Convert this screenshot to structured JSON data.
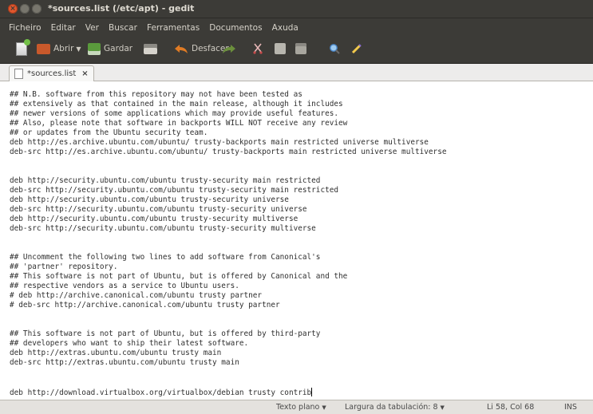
{
  "window": {
    "title": "*sources.list (/etc/apt) - gedit"
  },
  "menubar": {
    "items": [
      "Ficheiro",
      "Editar",
      "Ver",
      "Buscar",
      "Ferramentas",
      "Documentos",
      "Axuda"
    ]
  },
  "toolbar": {
    "open_label": "Abrir",
    "save_label": "Gardar",
    "undo_label": "Desfacer"
  },
  "tab": {
    "label": "*sources.list",
    "close": "×"
  },
  "editor": {
    "lines": [
      "## N.B. software from this repository may not have been tested as",
      "## extensively as that contained in the main release, although it includes",
      "## newer versions of some applications which may provide useful features.",
      "## Also, please note that software in backports WILL NOT receive any review",
      "## or updates from the Ubuntu security team.",
      "deb http://es.archive.ubuntu.com/ubuntu/ trusty-backports main restricted universe multiverse",
      "deb-src http://es.archive.ubuntu.com/ubuntu/ trusty-backports main restricted universe multiverse",
      "",
      "deb http://security.ubuntu.com/ubuntu trusty-security main restricted",
      "deb-src http://security.ubuntu.com/ubuntu trusty-security main restricted",
      "deb http://security.ubuntu.com/ubuntu trusty-security universe",
      "deb-src http://security.ubuntu.com/ubuntu trusty-security universe",
      "deb http://security.ubuntu.com/ubuntu trusty-security multiverse",
      "deb-src http://security.ubuntu.com/ubuntu trusty-security multiverse",
      "",
      "## Uncomment the following two lines to add software from Canonical's",
      "## 'partner' repository.",
      "## This software is not part of Ubuntu, but is offered by Canonical and the",
      "## respective vendors as a service to Ubuntu users.",
      "# deb http://archive.canonical.com/ubuntu trusty partner",
      "# deb-src http://archive.canonical.com/ubuntu trusty partner",
      "",
      "## This software is not part of Ubuntu, but is offered by third-party",
      "## developers who want to ship their latest software.",
      "deb http://extras.ubuntu.com/ubuntu trusty main",
      "deb-src http://extras.ubuntu.com/ubuntu trusty main",
      "",
      "deb http://download.virtualbox.org/virtualbox/debian trusty contrib"
    ]
  },
  "statusbar": {
    "syntax": "Texto plano",
    "tab_width": "Largura da tabulación: 8",
    "position": "Li 58, Col 68",
    "insert_mode": "INS"
  },
  "colors": {
    "chrome_dark": "#3c3b37",
    "close_button": "#e2572d",
    "editor_bg": "#ffffff"
  }
}
